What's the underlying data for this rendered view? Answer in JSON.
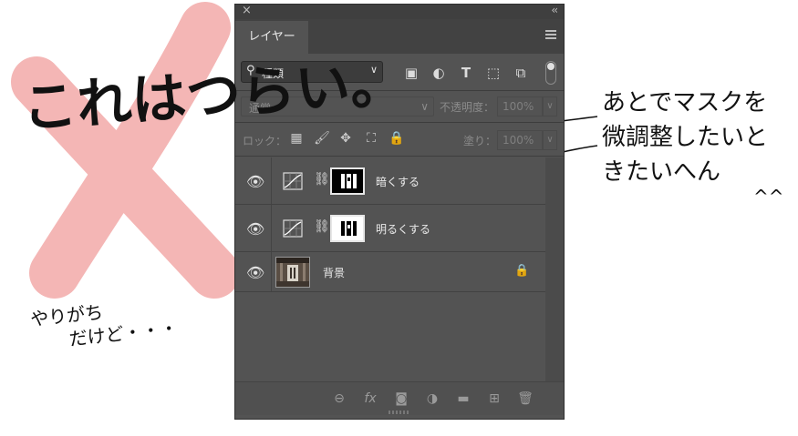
{
  "annotations": {
    "big_text": "これはつらい。",
    "small_text_line1": "やりがち",
    "small_text_line2": "だけど・・・",
    "right_text": "あとでマスクを微調整したいときたいへん",
    "face": "^^",
    "colors": {
      "cross": "#f4b6b5",
      "ink": "#111111"
    }
  },
  "panel": {
    "close_icon": "×",
    "collapse_icon": "‹‹",
    "tab_label": "レイヤー",
    "filter": {
      "icon": "search-icon",
      "label": "種類",
      "arrow": "∨"
    },
    "filter_icons": [
      "image-icon",
      "adjustment-icon",
      "type-icon",
      "shape-icon",
      "smart-object-icon"
    ],
    "blend_mode": "通常",
    "opacity_label": "不透明度：",
    "opacity_value": "100%",
    "lock_label": "ロック：",
    "fill_label": "塗り：",
    "fill_value": "100%",
    "layers": [
      {
        "name": "暗くする",
        "type": "adjustment",
        "mask": "black"
      },
      {
        "name": "明るくする",
        "type": "adjustment",
        "mask": "white"
      },
      {
        "name": "背景",
        "type": "image",
        "locked": true
      }
    ],
    "bottom_icons": [
      "link-icon",
      "fx-icon",
      "mask-icon",
      "adjustment-icon",
      "folder-icon",
      "new-layer-icon",
      "trash-icon"
    ],
    "fx_label": "fx",
    "colors": {
      "panel": "#535353",
      "dark": "#424242",
      "text": "#eaeaea",
      "muted": "#8b8b8b"
    }
  }
}
